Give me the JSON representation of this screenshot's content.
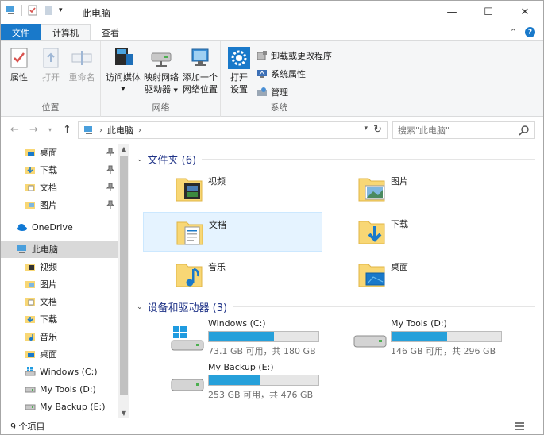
{
  "window": {
    "title": "此电脑"
  },
  "window_controls": {
    "minimize": "—",
    "maximize": "☐",
    "close": "✕"
  },
  "ribbon_tabs": {
    "file": "文件",
    "computer": "计算机",
    "view": "查看"
  },
  "ribbon": {
    "location_group": {
      "label": "位置",
      "properties": "属性",
      "open": "打开",
      "rename": "重命名"
    },
    "network_group": {
      "label": "网络",
      "access_media": "访问媒体",
      "map_drive_1": "映射网络",
      "map_drive_2": "驱动器",
      "add_location_1": "添加一个",
      "add_location_2": "网络位置"
    },
    "system_group": {
      "label": "系统",
      "open_settings_1": "打开",
      "open_settings_2": "设置",
      "uninstall": "卸载或更改程序",
      "system_properties": "系统属性",
      "manage": "管理"
    }
  },
  "address": {
    "crumb": "此电脑",
    "search_placeholder": "搜索\"此电脑\""
  },
  "nav": {
    "quick_access": [
      {
        "label": "桌面"
      },
      {
        "label": "下载"
      },
      {
        "label": "文档"
      },
      {
        "label": "图片"
      }
    ],
    "onedrive": "OneDrive",
    "this_pc": "此电脑",
    "pc_children": [
      {
        "label": "视频"
      },
      {
        "label": "图片"
      },
      {
        "label": "文档"
      },
      {
        "label": "下载"
      },
      {
        "label": "音乐"
      },
      {
        "label": "桌面"
      },
      {
        "label": "Windows (C:)"
      },
      {
        "label": "My Tools (D:)"
      },
      {
        "label": "My Backup (E:)"
      }
    ]
  },
  "content": {
    "folders_header": "文件夹 (6)",
    "folders": [
      {
        "label": "视频"
      },
      {
        "label": "图片"
      },
      {
        "label": "文档"
      },
      {
        "label": "下载"
      },
      {
        "label": "音乐"
      },
      {
        "label": "桌面"
      }
    ],
    "drives_header": "设备和驱动器 (3)",
    "drives": [
      {
        "name": "Windows (C:)",
        "free": "73.1 GB 可用，共 180 GB",
        "used_fraction": 0.594
      },
      {
        "name": "My Tools (D:)",
        "free": "146 GB 可用，共 296 GB",
        "used_fraction": 0.507
      },
      {
        "name": "My Backup (E:)",
        "free": "253 GB 可用，共 476 GB",
        "used_fraction": 0.468
      }
    ]
  },
  "status": {
    "item_count": "9 个项目"
  },
  "colors": {
    "accent": "#1979ca",
    "folder": "#f8d775",
    "drive_fill": "#26a0da",
    "header": "#1e3287"
  }
}
